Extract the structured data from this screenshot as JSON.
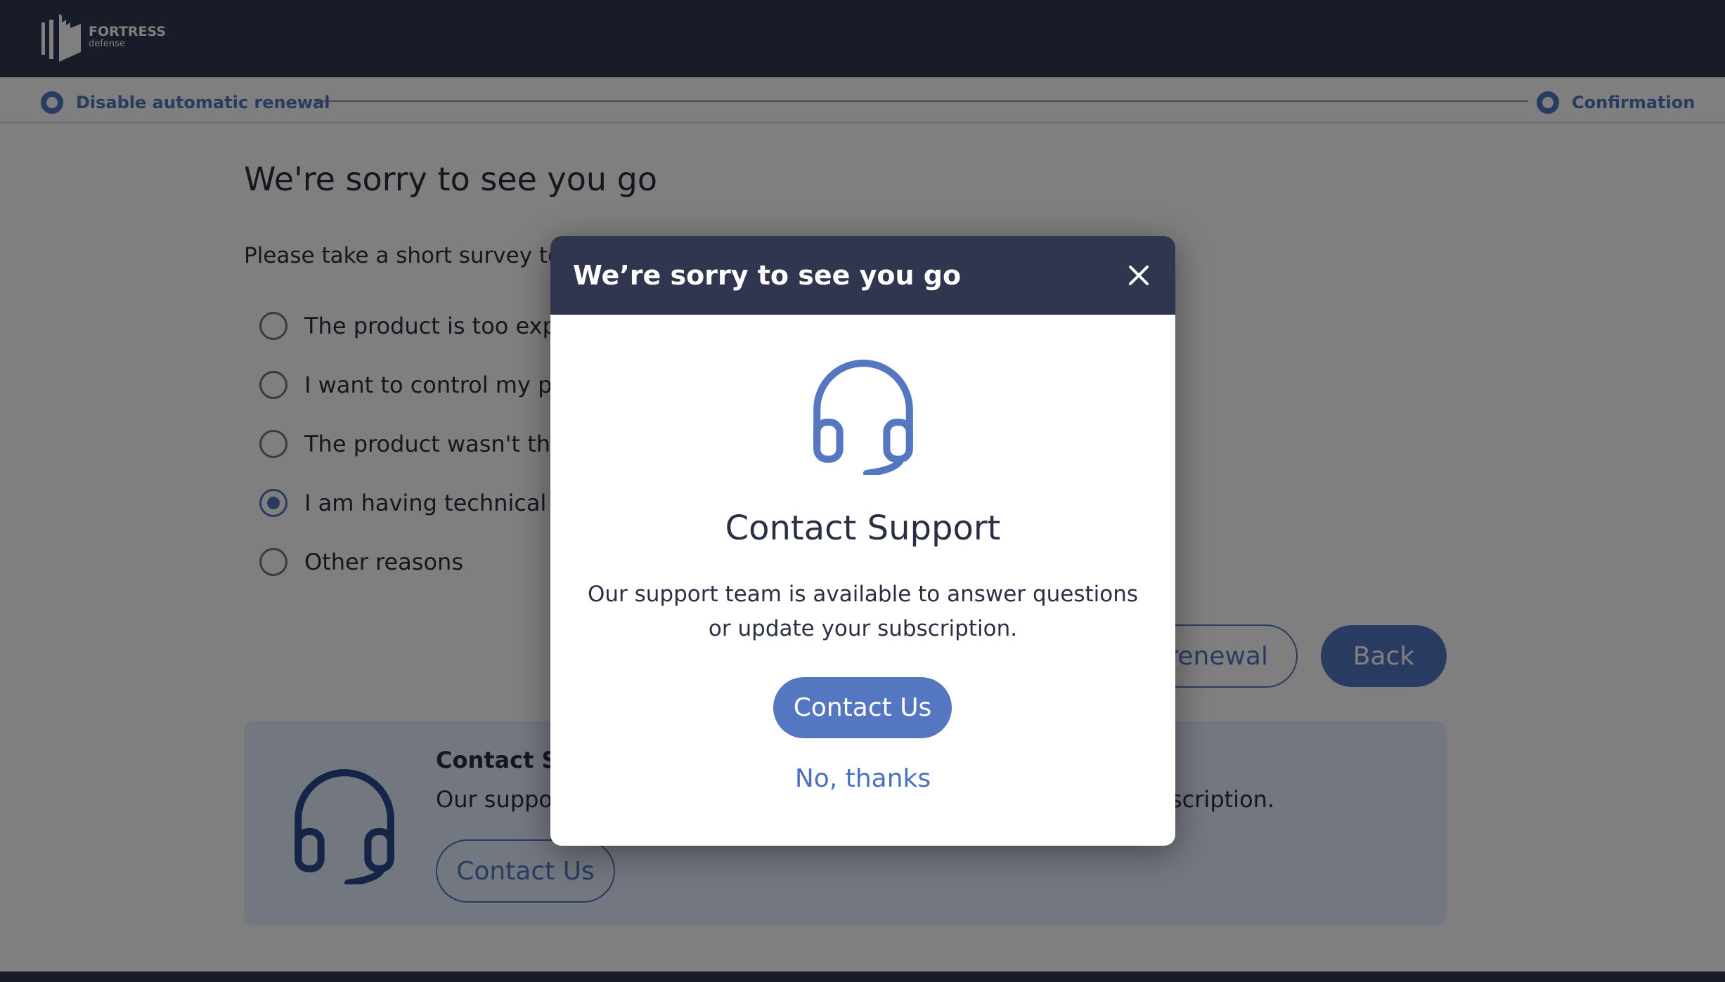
{
  "brand": {
    "name": "FORTRESS",
    "sub": "defense"
  },
  "stepper": {
    "steps": [
      {
        "label": "Disable automatic renewal"
      },
      {
        "label": "Confirmation"
      }
    ]
  },
  "page": {
    "title": "We're sorry to see you go",
    "survey_prompt": "Please take a short survey to",
    "options": [
      {
        "label": "The product is too expe",
        "selected": false
      },
      {
        "label": "I want to control my pay",
        "selected": false
      },
      {
        "label": "The product wasn't the",
        "selected": false
      },
      {
        "label": "I am having technical di",
        "selected": true
      },
      {
        "label": "Other reasons",
        "selected": false
      }
    ],
    "renewal_button": "renewal",
    "back_button": "Back",
    "support_card": {
      "title": "Contact Su",
      "desc_start": "Our suppo",
      "desc_end": "scription.",
      "button": "Contact Us"
    }
  },
  "modal": {
    "title": "We’re sorry to see you go",
    "heading": "Contact Support",
    "desc_line1": "Our support team is available to answer questions",
    "desc_line2": "or update your subscription.",
    "primary_button": "Contact Us",
    "secondary_link": "No, thanks"
  },
  "colors": {
    "accent": "#5577c2",
    "header": "#303850",
    "modal_header": "#303550",
    "card_bg": "#e6eeff"
  }
}
